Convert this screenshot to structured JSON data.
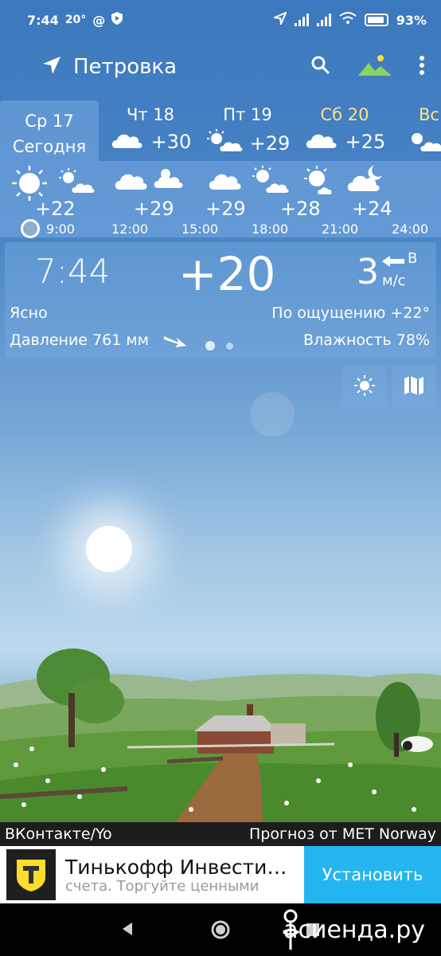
{
  "status": {
    "time": "7:44",
    "temp": "20°",
    "at": "@",
    "battery": "93%"
  },
  "header": {
    "location": "Петровка"
  },
  "days": [
    {
      "name": "Ср 17",
      "label": "Сегодня",
      "icon": "sun-icon"
    },
    {
      "name": "Чт 18",
      "temp": "+30",
      "icon": "cloud-icon"
    },
    {
      "name": "Пт 19",
      "temp": "+29",
      "icon": "sun-cloud-icon"
    },
    {
      "name": "Сб 20",
      "temp": "+25",
      "icon": "cloud-icon"
    },
    {
      "name": "Вс",
      "icon": "sun-cloud-icon"
    }
  ],
  "hours": [
    {
      "temp": "+22",
      "time": "9:00"
    },
    {
      "temp": "+29",
      "time": "12:00"
    },
    {
      "temp": "+29",
      "time": "15:00"
    },
    {
      "temp": "+28",
      "time": "18:00"
    },
    {
      "temp": "+24",
      "time": "21:00"
    },
    {
      "time": "24:00"
    }
  ],
  "current": {
    "time": "7:44",
    "temp": "+20",
    "wind_speed": "3",
    "wind_dir": "В",
    "wind_unit": "м/с",
    "condition": "Ясно",
    "feels_like": "По ощущению +22°",
    "pressure": "Давление 761 мм",
    "humidity": "Влажность 78%"
  },
  "footer": {
    "left": "ВКонтакте/Yo",
    "right": "Прогноз от MET Norway"
  },
  "ad": {
    "title": "Тинькофф Инвести…",
    "subtitle": "счета. Торгуйте ценными",
    "button": "Установить"
  },
  "watermark": "асиенда.ру"
}
